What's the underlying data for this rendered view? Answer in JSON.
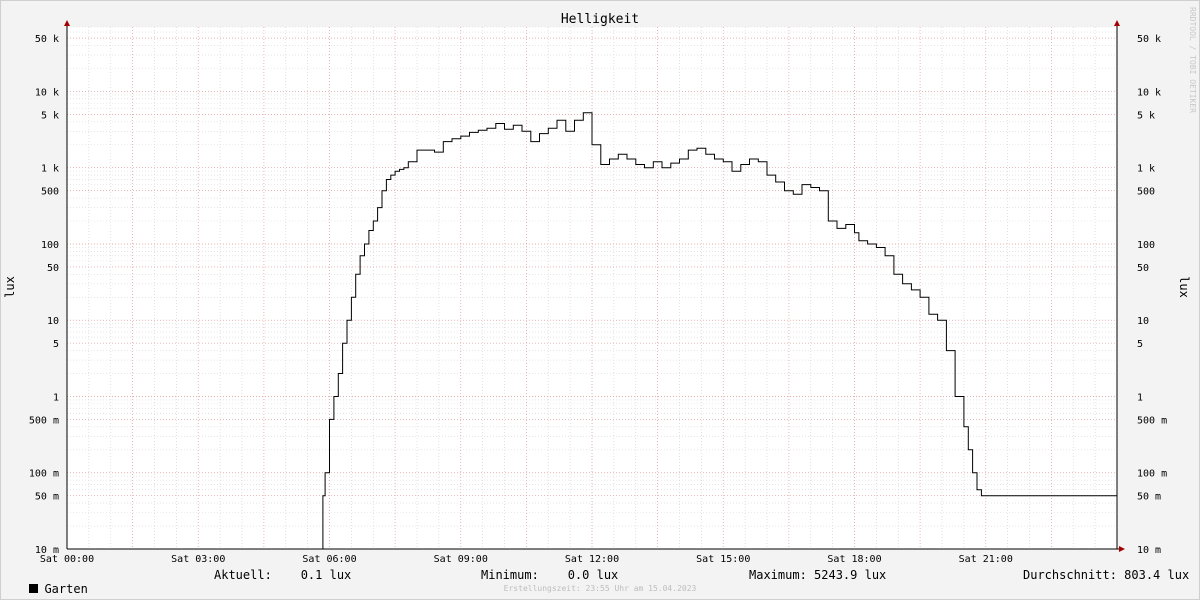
{
  "chart_data": {
    "type": "line",
    "title": "Helligkeit",
    "ylabel": "lux",
    "yscale": "log",
    "ylim": [
      0.01,
      70000
    ],
    "xlim": [
      0,
      24
    ],
    "watermark": "RRDTOOL / TOBI OETIKER",
    "x_ticks": [
      {
        "value": 0,
        "label": "Sat 00:00"
      },
      {
        "value": 3,
        "label": "Sat 03:00"
      },
      {
        "value": 6,
        "label": "Sat 06:00"
      },
      {
        "value": 9,
        "label": "Sat 09:00"
      },
      {
        "value": 12,
        "label": "Sat 12:00"
      },
      {
        "value": 15,
        "label": "Sat 15:00"
      },
      {
        "value": 18,
        "label": "Sat 18:00"
      },
      {
        "value": 21,
        "label": "Sat 21:00"
      }
    ],
    "y_ticks": [
      {
        "value": 50000,
        "label": "50 k"
      },
      {
        "value": 10000,
        "label": "10 k"
      },
      {
        "value": 5000,
        "label": "5 k"
      },
      {
        "value": 1000,
        "label": "1 k"
      },
      {
        "value": 500,
        "label": "500"
      },
      {
        "value": 100,
        "label": "100"
      },
      {
        "value": 50,
        "label": "50"
      },
      {
        "value": 10,
        "label": "10"
      },
      {
        "value": 5,
        "label": "5"
      },
      {
        "value": 1,
        "label": "1"
      },
      {
        "value": 0.5,
        "label": "500 m"
      },
      {
        "value": 0.1,
        "label": "100 m"
      },
      {
        "value": 0.05,
        "label": "50 m"
      },
      {
        "value": 0.01,
        "label": "10 m"
      }
    ],
    "grid": true,
    "series": [
      {
        "name": "Garten",
        "color": "#000000",
        "x": [
          0,
          5.8,
          5.85,
          5.9,
          6.0,
          6.1,
          6.2,
          6.3,
          6.4,
          6.5,
          6.6,
          6.7,
          6.8,
          6.9,
          7.0,
          7.1,
          7.2,
          7.3,
          7.4,
          7.5,
          7.6,
          7.7,
          7.8,
          8.0,
          8.2,
          8.4,
          8.6,
          8.8,
          9.0,
          9.2,
          9.4,
          9.6,
          9.8,
          10.0,
          10.2,
          10.4,
          10.6,
          10.8,
          11.0,
          11.2,
          11.4,
          11.6,
          11.8,
          12.0,
          12.2,
          12.4,
          12.6,
          12.8,
          13.0,
          13.2,
          13.4,
          13.6,
          13.8,
          14.0,
          14.2,
          14.4,
          14.6,
          14.8,
          15.0,
          15.2,
          15.4,
          15.6,
          15.8,
          16.0,
          16.2,
          16.4,
          16.6,
          16.8,
          17.0,
          17.2,
          17.4,
          17.6,
          17.8,
          18.0,
          18.1,
          18.3,
          18.5,
          18.7,
          18.9,
          19.1,
          19.3,
          19.5,
          19.7,
          19.9,
          20.1,
          20.3,
          20.5,
          20.6,
          20.7,
          20.8,
          20.9,
          21.0,
          24.0
        ],
        "values": [
          0.01,
          0.01,
          0.05,
          0.1,
          0.5,
          1.0,
          2.0,
          5.0,
          10,
          20,
          40,
          70,
          100,
          150,
          200,
          300,
          500,
          700,
          800,
          900,
          950,
          1000,
          1200,
          1700,
          1700,
          1600,
          2200,
          2400,
          2600,
          2900,
          3100,
          3300,
          3800,
          3200,
          3600,
          3000,
          2200,
          2800,
          3300,
          4200,
          3000,
          4200,
          5243.9,
          2000,
          1100,
          1300,
          1500,
          1300,
          1100,
          1000,
          1200,
          1000,
          1150,
          1300,
          1700,
          1800,
          1500,
          1300,
          1200,
          900,
          1100,
          1300,
          1200,
          800,
          650,
          500,
          450,
          600,
          550,
          500,
          200,
          160,
          180,
          140,
          110,
          100,
          90,
          70,
          40,
          30,
          25,
          20,
          12,
          10,
          4,
          1.0,
          0.4,
          0.2,
          0.1,
          0.06,
          0.05,
          0.05,
          0.05
        ]
      }
    ]
  },
  "legend": {
    "series_name": "Garten",
    "current": "Aktuell:    0.1 lux",
    "minimum": "Minimum:    0.0 lux",
    "maximum": "Maximum: 5243.9 lux",
    "average": "Durchschnitt: 803.4 lux"
  },
  "footer": "Erstellungszeit: 23:55 Uhr am 15.04.2023"
}
